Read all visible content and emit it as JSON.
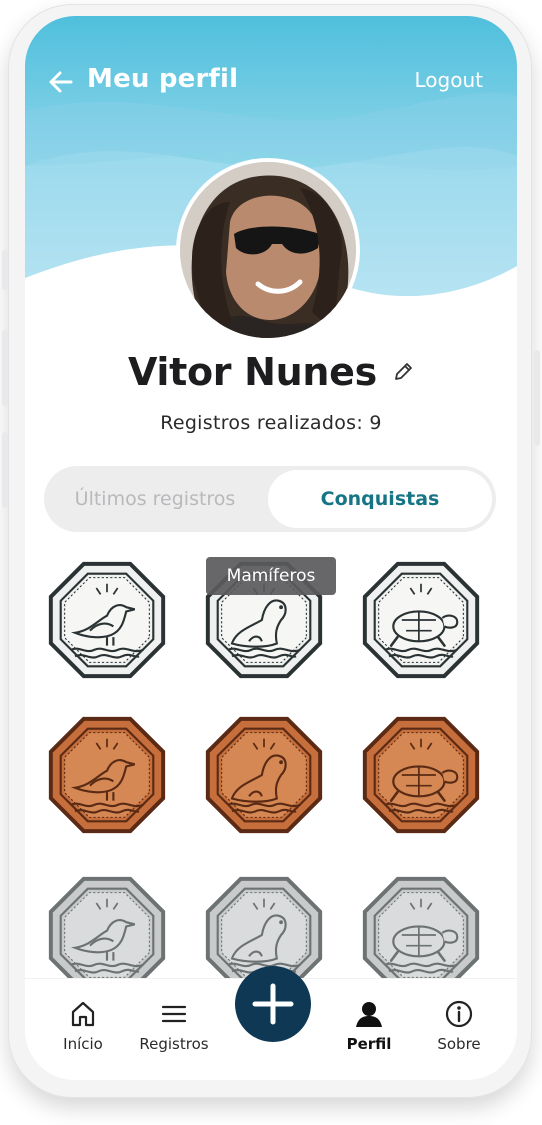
{
  "header": {
    "title": "Meu perfil",
    "logout_label": "Logout",
    "back_icon": "arrow-left-icon"
  },
  "profile": {
    "name": "Vitor Nunes",
    "records_text": "Registros realizados: 9",
    "edit_icon": "pencil-icon"
  },
  "tabs": [
    {
      "label": "Últimos registros",
      "active": false
    },
    {
      "label": "Conquistas",
      "active": true
    }
  ],
  "tooltip": "Mamíferos",
  "badges": [
    {
      "animal": "bird",
      "tier": "platinum"
    },
    {
      "animal": "seal",
      "tier": "platinum"
    },
    {
      "animal": "turtle",
      "tier": "platinum"
    },
    {
      "animal": "bird",
      "tier": "bronze"
    },
    {
      "animal": "seal",
      "tier": "bronze"
    },
    {
      "animal": "turtle",
      "tier": "bronze"
    },
    {
      "animal": "bird",
      "tier": "silver"
    },
    {
      "animal": "seal",
      "tier": "silver"
    },
    {
      "animal": "turtle",
      "tier": "silver"
    }
  ],
  "nav": [
    {
      "label": "Início",
      "icon": "home-icon"
    },
    {
      "label": "Registros",
      "icon": "menu-icon"
    },
    {
      "label": "Perfil",
      "icon": "person-icon",
      "active": true
    },
    {
      "label": "Sobre",
      "icon": "info-icon"
    }
  ],
  "fab_icon": "plus-icon",
  "colors": {
    "header_gradient": [
      "#5cc4df",
      "#d2eef7"
    ],
    "accent": "#167584",
    "fab": "#0f3855",
    "bronze": "#c8713c",
    "silver": "#c9cbcc"
  }
}
